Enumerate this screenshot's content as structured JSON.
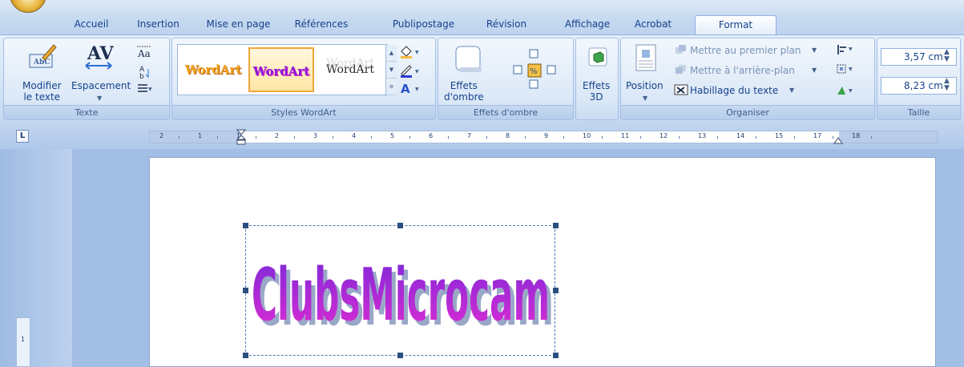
{
  "tabs": [
    "Accueil",
    "Insertion",
    "Mise en page",
    "Références",
    "Publipostage",
    "Révision",
    "Affichage",
    "Acrobat",
    "Format"
  ],
  "active_tab": "Format",
  "groups": {
    "texte": {
      "label": "Texte",
      "modifier": "Modifier\nle texte",
      "espacement": "Espacement"
    },
    "styles_wordart": {
      "label": "Styles WordArt",
      "samples": [
        "WordArt",
        "WordArt",
        "WordArt"
      ]
    },
    "effets_ombre": {
      "label": "Effets d'ombre",
      "button": "Effets\nd'ombre"
    },
    "effets_3d": {
      "button": "Effets\n3D"
    },
    "organiser": {
      "label": "Organiser",
      "position": "Position",
      "premier_plan": "Mettre au premier plan",
      "arriere_plan": "Mettre à l'arrière-plan",
      "habillage": "Habillage du texte"
    },
    "taille": {
      "label": "Taille",
      "height": "3,57 cm",
      "width": "8,23 cm"
    }
  },
  "ruler_labels": [
    "2",
    "1",
    "1",
    "2",
    "3",
    "4",
    "5",
    "6",
    "7",
    "8",
    "9",
    "10",
    "11",
    "12",
    "13",
    "14",
    "15",
    "17",
    "18"
  ],
  "vruler_label": "1",
  "ruler_tab_glyph": "L",
  "wordart_text": "ClubsMicrocam",
  "colors": {
    "wordart_top": "#7a2ad8",
    "wordart_bottom": "#e02bd2",
    "wordart_shadow": "#9aa8c8",
    "accent": "#15428b"
  }
}
